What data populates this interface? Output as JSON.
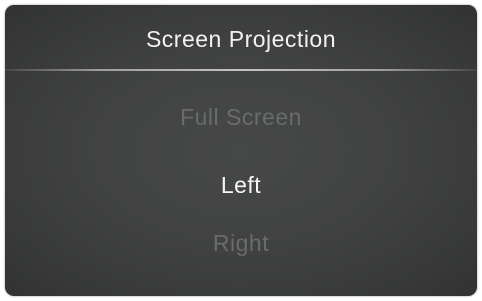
{
  "dialog": {
    "title": "Screen Projection",
    "options": [
      {
        "label": "Full Screen",
        "state": "disabled"
      },
      {
        "label": "Left",
        "state": "selected"
      },
      {
        "label": "Right",
        "state": "disabled"
      }
    ]
  },
  "colors": {
    "background": "#414242",
    "text_active": "#f6f6f6",
    "text_disabled": "#6a6b6b"
  }
}
